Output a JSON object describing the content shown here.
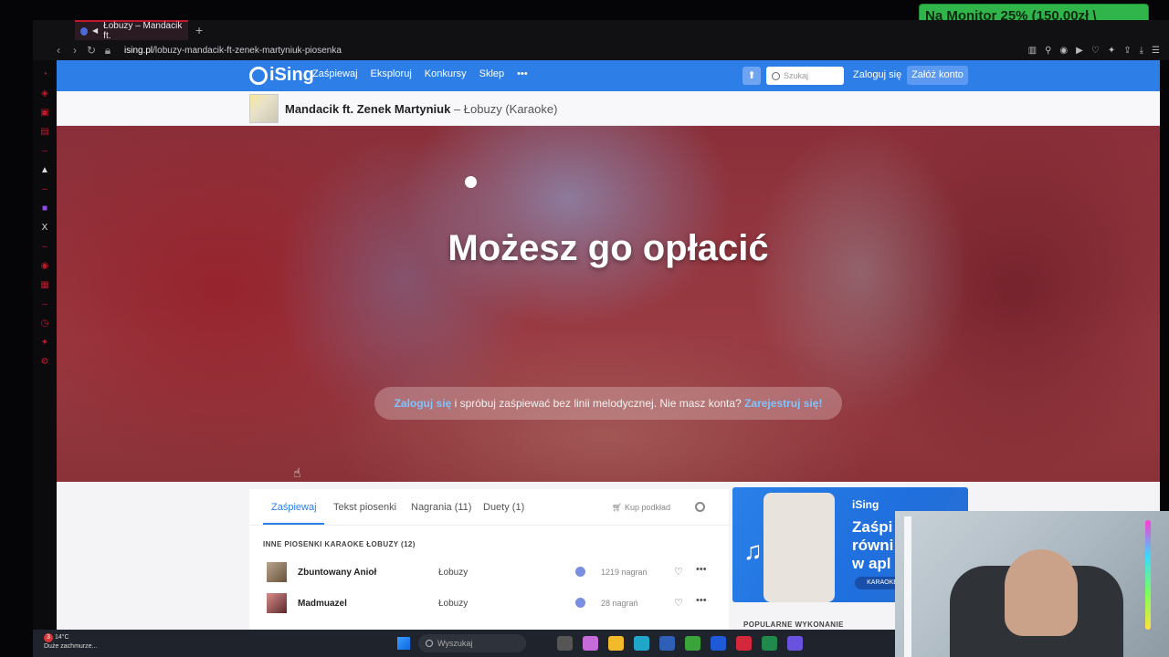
{
  "overlay": {
    "banner": "Na Monitor 25% (150.00zł \\"
  },
  "browser": {
    "tab_title": "Łobuzy – Mandacik ft.",
    "url_host": "ising.pl",
    "url_path": "/lobuzy-mandacik-ft-zenek-martyniuk-piosenka"
  },
  "nav": {
    "logo": "iSing",
    "links": [
      "Zaśpiewaj",
      "Eksploruj",
      "Konkursy",
      "Sklep",
      "•••"
    ],
    "search_placeholder": "Szukaj",
    "login": "Zaloguj się",
    "register": "Załóż konto"
  },
  "song": {
    "artist": "Mandacik ft. Zenek Martyniuk",
    "title_rest": " – Łobuzy (Karaoke)"
  },
  "player": {
    "lyric": "Możesz go opłacić",
    "hint_login": "Zaloguj się",
    "hint_mid": " i spróbuj zaśpiewać bez linii melodycznej. Nie masz konta? ",
    "hint_register": "Zarejestruj się!"
  },
  "tabs": {
    "items": [
      "Zaśpiewaj",
      "Tekst piosenki",
      "Nagrania (11)",
      "Duety (1)"
    ],
    "buy": "Kup podkład"
  },
  "other_songs": {
    "heading": "INNE PIOSENKI KARAOKE ŁOBUZY (12)",
    "rows": [
      {
        "name": "Zbuntowany Anioł",
        "artist": "Łobuzy",
        "count": "1219 nagrań"
      },
      {
        "name": "Madmuazel",
        "artist": "Łobuzy",
        "count": "28 nagrań"
      }
    ]
  },
  "ad": {
    "logo": "iSing",
    "text": "Zaśpi\nrówni\nw apl",
    "pill": "KARAOKE"
  },
  "popular": "POPULARNE WYKONANIE",
  "taskbar": {
    "temp": "14°C",
    "weather": "Duże zachmurze...",
    "notif": "3",
    "search": "Wyszukaj"
  }
}
